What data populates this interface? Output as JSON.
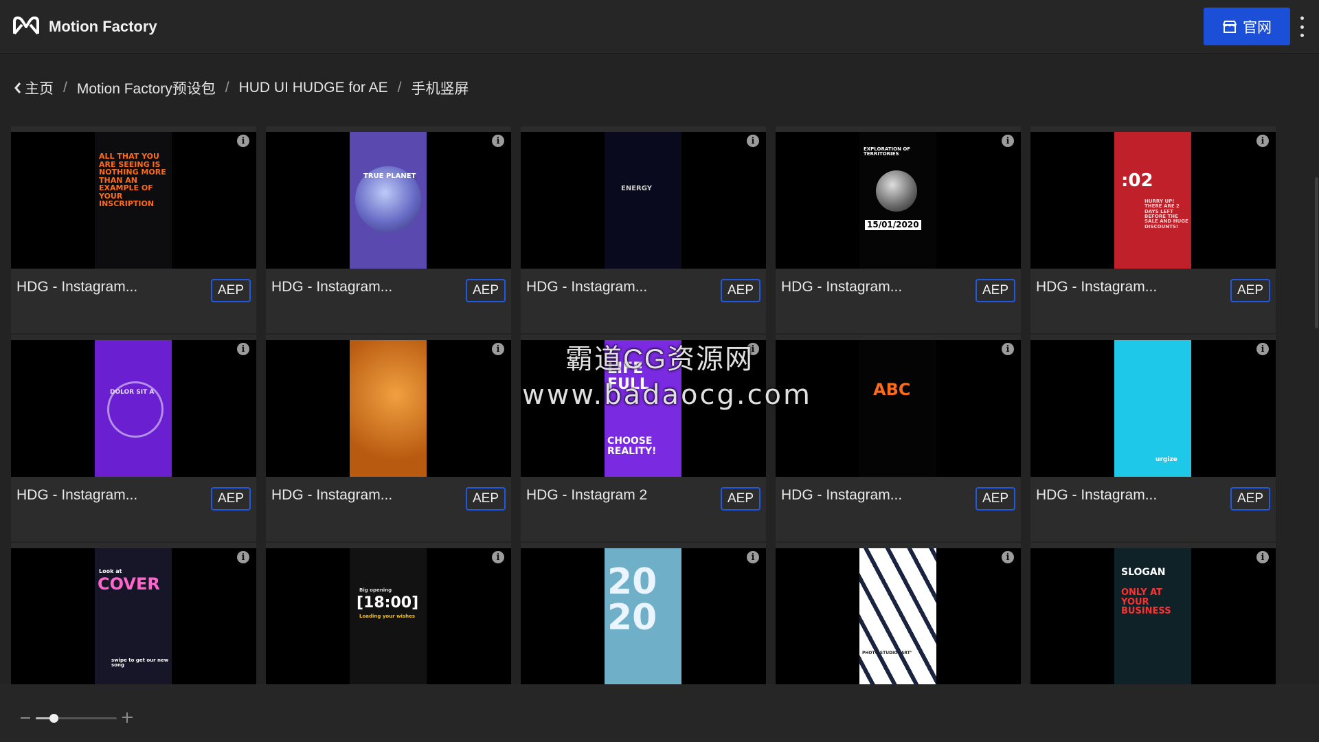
{
  "app": {
    "title": "Motion Factory",
    "site_button": "官网"
  },
  "breadcrumb": {
    "home": "主页",
    "items": [
      "Motion Factory预设包",
      "HUD UI HUDGE for AE",
      "手机竖屏"
    ]
  },
  "cards": [
    {
      "name": "HDG - Instagram...",
      "badge": "AEP"
    },
    {
      "name": "HDG - Instagram...",
      "badge": "AEP"
    },
    {
      "name": "HDG - Instagram...",
      "badge": "AEP"
    },
    {
      "name": "HDG - Instagram...",
      "badge": "AEP"
    },
    {
      "name": "HDG - Instagram...",
      "badge": "AEP"
    },
    {
      "name": "HDG - Instagram...",
      "badge": "AEP"
    },
    {
      "name": "HDG - Instagram...",
      "badge": "AEP"
    },
    {
      "name": "HDG - Instagram 2",
      "badge": "AEP"
    },
    {
      "name": "HDG - Instagram...",
      "badge": "AEP"
    },
    {
      "name": "HDG - Instagram...",
      "badge": "AEP"
    },
    {
      "name": "",
      "badge": ""
    },
    {
      "name": "",
      "badge": ""
    },
    {
      "name": "",
      "badge": ""
    },
    {
      "name": "",
      "badge": ""
    },
    {
      "name": "",
      "badge": ""
    }
  ],
  "posters": [
    {
      "bg": "#0d0d10",
      "texts": [
        {
          "t": "ALL THAT YOU ARE SEEING IS NOTHING MORE THAN AN EXAMPLE OF YOUR INSCRIPTION",
          "c": "#ff6a1a",
          "s": 11
        }
      ]
    },
    {
      "bg": "#5a4ab0",
      "texts": [
        {
          "t": "TRUE PLANET",
          "c": "#ffffff",
          "s": 10
        }
      ]
    },
    {
      "bg": "#0a0a1e",
      "texts": [
        {
          "t": "ENERGY",
          "c": "#d0d0d0",
          "s": 10
        }
      ]
    },
    {
      "bg": "#050505",
      "texts": [
        {
          "t": "EXPLORATION OF TERRITORIES",
          "c": "#ffffff",
          "s": 7
        },
        {
          "t": "15/01/2020",
          "c": "#000000",
          "s": 12
        }
      ]
    },
    {
      "bg": "#c0202a",
      "texts": [
        {
          "t": ":02",
          "c": "#ffffff",
          "s": 26
        },
        {
          "t": "HURRY UP! THERE ARE 2 DAYS LEFT BEFORE THE SALE AND HUGE DISCOUNTS!",
          "c": "#ffd0d0",
          "s": 7
        }
      ]
    },
    {
      "bg": "#6a1fd0",
      "texts": [
        {
          "t": "DOLOR SIT A",
          "c": "#e8e0ff",
          "s": 9
        }
      ]
    },
    {
      "bg": "#d9781c",
      "texts": []
    },
    {
      "bg": "#7a2ae0",
      "texts": [
        {
          "t": "LIFE FULL",
          "c": "#ffffff",
          "s": 22
        },
        {
          "t": "CHOOSE REALITY!",
          "c": "#ffffff",
          "s": 14
        }
      ]
    },
    {
      "bg": "#040404",
      "texts": [
        {
          "t": "ABC",
          "c": "#ff6a1a",
          "s": 24
        }
      ]
    },
    {
      "bg": "#1ec8e8",
      "texts": [
        {
          "t": "urgize",
          "c": "#ffffff",
          "s": 9
        }
      ]
    },
    {
      "bg": "#161628",
      "texts": [
        {
          "t": "Look at",
          "c": "#ffffff",
          "s": 8
        },
        {
          "t": "COVER",
          "c": "#ff66cc",
          "s": 24
        },
        {
          "t": "swipe to get our new song",
          "c": "#ffffff",
          "s": 7
        }
      ]
    },
    {
      "bg": "#121212",
      "texts": [
        {
          "t": "Big opening",
          "c": "#dddddd",
          "s": 7
        },
        {
          "t": "[18:00]",
          "c": "#ffffff",
          "s": 22
        },
        {
          "t": "Loading your wishes",
          "c": "#f0c020",
          "s": 7
        }
      ]
    },
    {
      "bg": "#6fb0c8",
      "texts": [
        {
          "t": "20",
          "c": "#eaf5ff",
          "s": 52
        },
        {
          "t": "20",
          "c": "#eaf5ff",
          "s": 52
        }
      ]
    },
    {
      "bg": "#ffffff",
      "texts": [
        {
          "t": "PHOTO STUDIO \"ART\"",
          "c": "#222222",
          "s": 6
        }
      ]
    },
    {
      "bg": "#0e2228",
      "texts": [
        {
          "t": "SLOGAN",
          "c": "#ffffff",
          "s": 14
        },
        {
          "t": "ONLY AT YOUR BUSINESS",
          "c": "#ff3030",
          "s": 13
        }
      ]
    }
  ],
  "watermark": {
    "line1": "霸道CG资源网",
    "line2": "www.badaocg.com"
  },
  "zoom": {
    "value": 0.22
  },
  "colors": {
    "accent": "#1b4fd8",
    "badge_border": "#1e5ae6",
    "background": "#232323"
  }
}
